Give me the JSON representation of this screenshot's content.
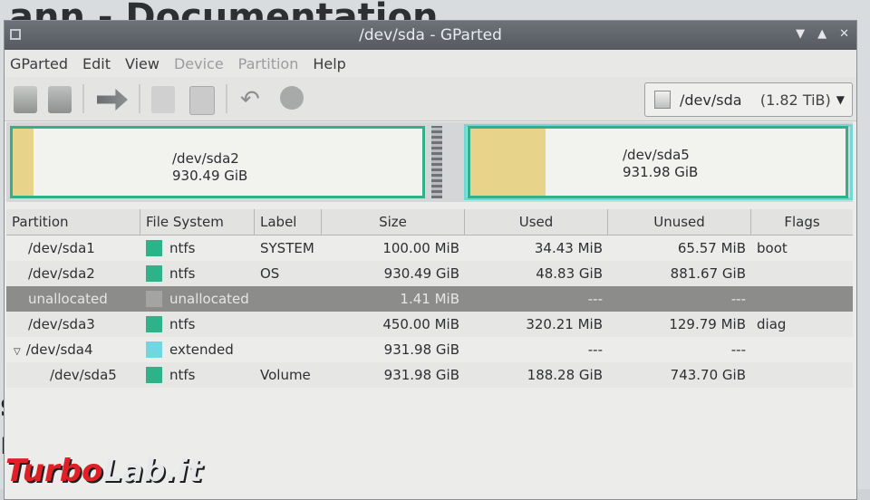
{
  "background_doc": {
    "title": "ann - Documentation",
    "letters": [
      "s",
      "r"
    ]
  },
  "window": {
    "title": "/dev/sda - GParted"
  },
  "menu": [
    {
      "label": "GParted",
      "enabled": true
    },
    {
      "label": "Edit",
      "enabled": true
    },
    {
      "label": "View",
      "enabled": true
    },
    {
      "label": "Device",
      "enabled": false
    },
    {
      "label": "Partition",
      "enabled": false
    },
    {
      "label": "Help",
      "enabled": true
    }
  ],
  "toolbar": {
    "icons": [
      "new-partition-icon",
      "delete-partition-icon",
      "resize-move-icon",
      "copy-icon",
      "paste-icon",
      "undo-icon",
      "apply-icon"
    ]
  },
  "device_selector": {
    "device": "/dev/sda",
    "size": "(1.82 TiB)"
  },
  "partition_map": {
    "sda2": {
      "name": "/dev/sda2",
      "size": "930.49 GiB",
      "used_fraction": 0.05
    },
    "sda5": {
      "name": "/dev/sda5",
      "size": "931.98 GiB",
      "used_fraction": 0.2
    }
  },
  "table": {
    "headers": [
      "Partition",
      "File System",
      "Label",
      "Size",
      "Used",
      "Unused",
      "Flags"
    ],
    "rows": [
      {
        "partition": "/dev/sda1",
        "fs": "ntfs",
        "fs_color": "#2db38a",
        "label": "SYSTEM",
        "size": "100.00 MiB",
        "used": "34.43 MiB",
        "unused": "65.57 MiB",
        "flags": "boot",
        "indent": 0
      },
      {
        "partition": "/dev/sda2",
        "fs": "ntfs",
        "fs_color": "#2db38a",
        "label": "OS",
        "size": "930.49 GiB",
        "used": "48.83 GiB",
        "unused": "881.67 GiB",
        "flags": "",
        "indent": 0
      },
      {
        "partition": "unallocated",
        "fs": "unallocated",
        "fs_color": "#a4a5a3",
        "label": "",
        "size": "1.41 MiB",
        "used": "---",
        "unused": "---",
        "flags": "",
        "indent": 0
      },
      {
        "partition": "/dev/sda3",
        "fs": "ntfs",
        "fs_color": "#2db38a",
        "label": "",
        "size": "450.00 MiB",
        "used": "320.21 MiB",
        "unused": "129.79 MiB",
        "flags": "diag",
        "indent": 0
      },
      {
        "partition": "/dev/sda4",
        "fs": "extended",
        "fs_color": "#72d6e0",
        "label": "",
        "size": "931.98 GiB",
        "used": "---",
        "unused": "---",
        "flags": "",
        "indent": 0
      },
      {
        "partition": "/dev/sda5",
        "fs": "ntfs",
        "fs_color": "#2db38a",
        "label": "Volume",
        "size": "931.98 GiB",
        "used": "188.28 GiB",
        "unused": "743.70 GiB",
        "flags": "",
        "indent": 1
      }
    ]
  },
  "watermark": {
    "part1": "Turbo",
    "part2": "Lab.it"
  }
}
